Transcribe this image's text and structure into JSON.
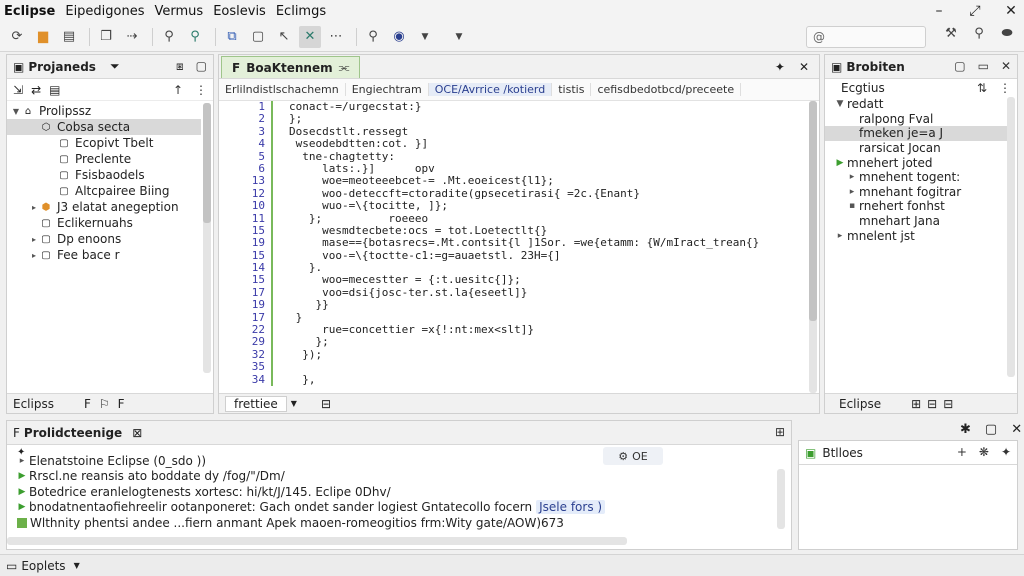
{
  "menubar": {
    "app": "Eclipse",
    "items": [
      "Eipedigones",
      "Vermus",
      "Eoslevis",
      "Eclimgs"
    ]
  },
  "window_controls": [
    "minimize-icon",
    "restore-icon",
    "close-icon"
  ],
  "toolbar": {
    "icons": [
      "refresh-icon",
      "package-icon",
      "save-icon",
      "copy-icon",
      "forward-icon",
      "search-icon",
      "search-alt-icon",
      "tools-icon",
      "file-icon",
      "cursor-icon",
      "x-icon",
      "more-icon",
      "zoom-icon",
      "target-icon"
    ],
    "search_placeholder": "@",
    "right_icons": [
      "wrench-icon",
      "search-icon",
      "toggle-icon"
    ]
  },
  "project_explorer": {
    "title": "Projaneds",
    "tree": [
      {
        "label": "Prolipssz",
        "depth": 0
      },
      {
        "label": "Cobsa secta",
        "depth": 1,
        "selected": true
      },
      {
        "label": "Ecopivt Tbelt",
        "depth": 2
      },
      {
        "label": "Preclente",
        "depth": 2
      },
      {
        "label": "Fsisbaodels",
        "depth": 2
      },
      {
        "label": "Altcpairee Biing",
        "depth": 2
      },
      {
        "label": "J3 elatat anegeption",
        "depth": 1
      },
      {
        "label": "Eclikernuahs",
        "depth": 1
      },
      {
        "label": "Dp enoons",
        "depth": 1
      },
      {
        "label": "Fee bace r",
        "depth": 1
      }
    ],
    "footer": "Eclipss"
  },
  "editor": {
    "tab_label": "BoaKtennem",
    "breadcrumbs": [
      "Erlilndistlschachemn",
      "Engiechtram",
      "OCE/Avrrice /kotierd",
      "tistis",
      "cefisdbedotbcd/preceete"
    ],
    "lines": [
      {
        "n": "1",
        "t": "conact-=/urgecstat:}",
        "c": "kw"
      },
      {
        "n": "2",
        "t": "};",
        "c": "plain"
      },
      {
        "n": "3",
        "t": "Dosecdstlt.ressegt",
        "c": "plain"
      },
      {
        "n": "4",
        "t": " wseodebdtten:cot. }]",
        "c": "kw"
      },
      {
        "n": "5",
        "t": "  tne-chagtetty:",
        "c": "plain"
      },
      {
        "n": "6",
        "t": "     lats:.}]      opv",
        "c": "str"
      },
      {
        "n": "13",
        "t": "     woe=meoteeebcet-= .Mt.eoeicest{l1};",
        "c": "kw"
      },
      {
        "n": "12",
        "t": "     woo-deteccft=ctoradite(gpsecetirasi{ =2c.{Enant}",
        "c": "kw"
      },
      {
        "n": "10",
        "t": "     wuo-=\\{tocitte, ]};",
        "c": "str"
      },
      {
        "n": "11",
        "t": "   };          roeeeo",
        "c": "plain"
      },
      {
        "n": "15",
        "t": "     wesmdtecbete:ocs = tot.Loetectlt{}",
        "c": "str"
      },
      {
        "n": "19",
        "t": "     mase=={botasrecs=.Mt.contsit{l ]1Sor. =we{etamm: {W/mIract_trean{}",
        "c": "kw"
      },
      {
        "n": "15",
        "t": "     voo-=\\{toctte-c1:=g=auaetstl. 23H={]",
        "c": "str"
      },
      {
        "n": "14",
        "t": "   }.",
        "c": "plain"
      },
      {
        "n": "15",
        "t": "     woo=mecestter = {:t.uesitc{]};",
        "c": "kw"
      },
      {
        "n": "17",
        "t": "     voo=dsi{josc-ter.st.la{eseetl]}",
        "c": "kw"
      },
      {
        "n": "19",
        "t": "    }}",
        "c": "plain"
      },
      {
        "n": "17",
        "t": " }",
        "c": "plain"
      },
      {
        "n": "22",
        "t": "     rue=concettier =x{!:nt:mex<slt]}",
        "c": "kw"
      },
      {
        "n": "29",
        "t": "    };",
        "c": "plain"
      },
      {
        "n": "32",
        "t": "  });",
        "c": "plain"
      },
      {
        "n": "35",
        "t": "",
        "c": "plain"
      },
      {
        "n": "34",
        "t": "  },",
        "c": "plain"
      }
    ],
    "footer_label": "frettiee",
    "footer_icon": "lock-icon"
  },
  "outline": {
    "title": "Brobiten",
    "subheader": "Ecgtius",
    "items": [
      {
        "label": "redatt",
        "arrow": "down",
        "depth": 0
      },
      {
        "label": "ralpong Fval",
        "arrow": "",
        "depth": 1
      },
      {
        "label": "fmeken je=a J",
        "arrow": "",
        "depth": 1,
        "selected": true
      },
      {
        "label": "rarsicat Jocan",
        "arrow": "",
        "depth": 1
      },
      {
        "label": "mnehert joted",
        "arrow": "green",
        "depth": 0
      },
      {
        "label": "mnehent togent:",
        "arrow": "right",
        "depth": 1
      },
      {
        "label": "mnehant fogitrar",
        "arrow": "right",
        "depth": 1
      },
      {
        "label": "rnehert fonhst",
        "arrow": "dot",
        "depth": 1
      },
      {
        "label": "mnehart Jana",
        "arrow": "",
        "depth": 1
      },
      {
        "label": "mnelent jst",
        "arrow": "right2",
        "depth": 0
      }
    ],
    "footer": "Eclipse"
  },
  "console": {
    "title": "Prolidcteenige",
    "badge": "OE",
    "lines": [
      {
        "mark": "",
        "text": "Elenatstoine Eclipse (0_sdo ))"
      },
      {
        "mark": "arrow",
        "text": "Rrscl.ne reansis ato boddate dy /fog/\"/Dm/"
      },
      {
        "mark": "arrow",
        "text": "Botedrice eranlelogtenests xortesc: hi/kt/J/145. Eclipe 0Dhv/"
      },
      {
        "mark": "arrow",
        "text": "bnodatnentaofiehreelir ootanponeret: Gach ondet sander logiest Gntatecollo focern",
        "tag": "Jsele fors )"
      },
      {
        "mark": "square",
        "text": "Wlthnity phentsi andee ...fiern anmant Apek maoen-romeogitios frm:Wity gate/AOW)673"
      }
    ]
  },
  "bottom_right": {
    "title": "Btlloes"
  },
  "statusbar": {
    "label": "Eoplets"
  }
}
